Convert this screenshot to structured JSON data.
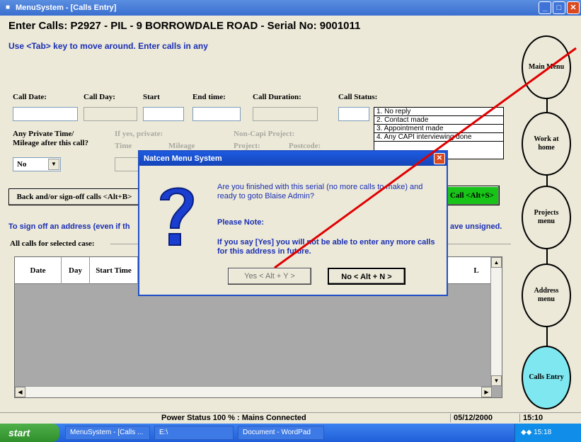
{
  "window": {
    "title": "MenuSystem - [Calls Entry]"
  },
  "page": {
    "title": "Enter Calls: P2927 - PIL - 9 BORROWDALE ROAD - Serial No: 9001011",
    "instructions": "Use <Tab> key to move around.  Enter calls in any"
  },
  "form": {
    "call_date_label": "Call Date:",
    "call_day_label": "Call Day:",
    "start_label": "Start",
    "end_time_label": "End time:",
    "duration_label": "Call Duration:",
    "status_label": "Call Status:",
    "private_time_label": "Any Private Time/",
    "mileage_after_label": "Mileage after this call?",
    "if_yes_label": "If yes, private:",
    "time_label": "Time",
    "mileage_label": "Mileage",
    "noncapi_label": "Non-Capi Project:",
    "project_label": "Project:",
    "postcode_label": "Postcode:",
    "private_select_value": "No",
    "status_options": [
      "1. No reply",
      "2. Contact made",
      "3. Appointment made",
      "4. Any CAPI interviewing done"
    ]
  },
  "buttons": {
    "back": "Back and/or sign-off calls <Alt+B>",
    "save": "Call <Alt+S>"
  },
  "notes": {
    "sign_off": "To sign off an address (even if th",
    "sign_off_right": "ave unsigned."
  },
  "grid": {
    "group_label": "All calls for selected case:",
    "columns": [
      "Date",
      "Day",
      "Start Time",
      "L"
    ]
  },
  "flow_menu": [
    "Main Menu",
    "Work at home",
    "Projects menu",
    "Address menu",
    "Calls Entry"
  ],
  "statusbar": {
    "power": "Power Status 100 % : Mains Connected",
    "date": "05/12/2000",
    "time": "15:10"
  },
  "taskbar": {
    "start": "start",
    "tasks": [
      "MenuSystem - [Calls ...",
      "E:\\",
      "Document - WordPad"
    ],
    "clock": "15:18"
  },
  "dialog": {
    "title": "Natcen Menu System",
    "message": "Are you finished with this serial (no more calls to make) and ready to goto Blaise Admin?",
    "note_heading": "Please Note:",
    "warning": "If you say [Yes] you will not be able to enter any more calls for this address in future.",
    "yes_label": "Yes < Alt + Y >",
    "no_label": "No < Alt + N >"
  },
  "colors": {
    "accent_text": "#1a2fb4",
    "save_button": "#18c418",
    "active_oval": "#7fe7f0",
    "annotation_line": "#e00000"
  }
}
